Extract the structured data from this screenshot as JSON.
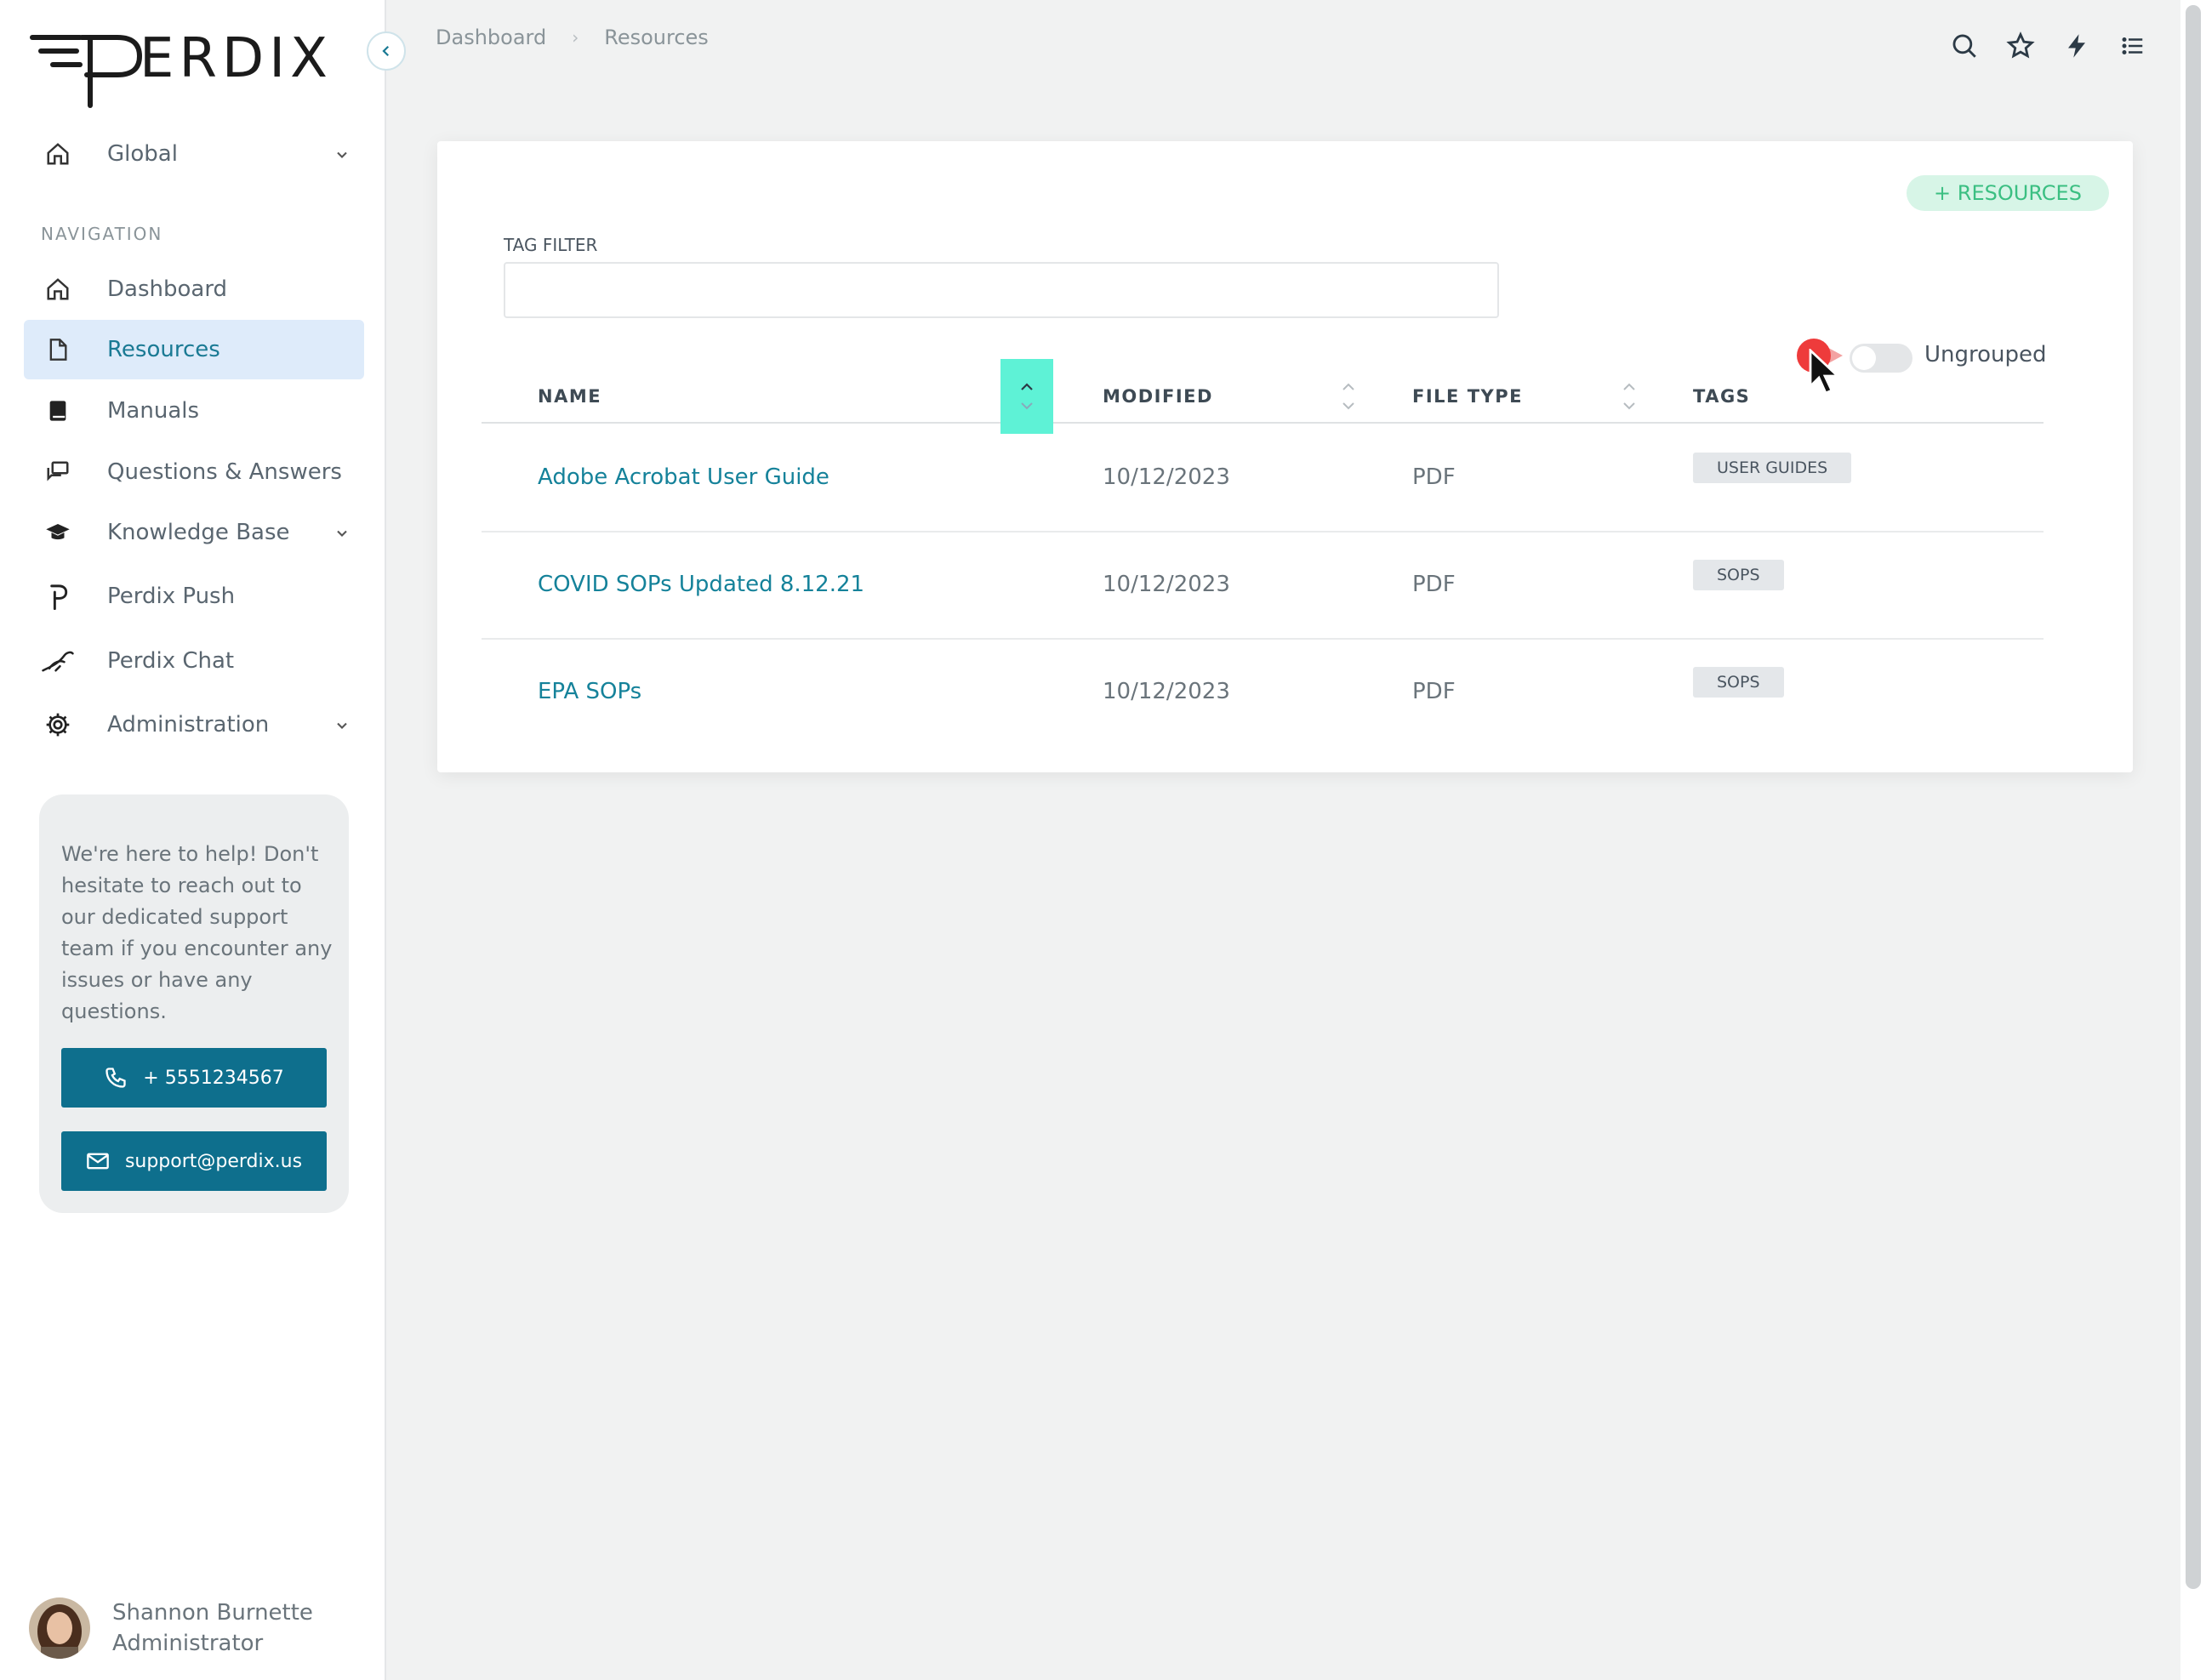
{
  "brand": {
    "logo_text": "PERDIX"
  },
  "breadcrumb": {
    "items": [
      "Dashboard",
      "Resources"
    ]
  },
  "sidebar": {
    "scope": "Global",
    "heading": "NAVIGATION",
    "items": [
      {
        "label": "Dashboard",
        "icon": "home-icon"
      },
      {
        "label": "Resources",
        "icon": "file-icon",
        "active": true
      },
      {
        "label": "Manuals",
        "icon": "book-icon"
      },
      {
        "label": "Questions & Answers",
        "icon": "chat-icon"
      },
      {
        "label": "Knowledge Base",
        "icon": "graduation-cap-icon",
        "expandable": true
      },
      {
        "label": "Perdix Push",
        "icon": "perdix-p-icon"
      },
      {
        "label": "Perdix Chat",
        "icon": "bird-icon"
      },
      {
        "label": "Administration",
        "icon": "gear-icon",
        "expandable": true
      }
    ]
  },
  "help": {
    "text": "We're here to help! Don't hesitate to reach out to our dedicated support team if you encounter any issues or have any questions.",
    "phone": "+ 5551234567",
    "email": "support@perdix.us"
  },
  "user": {
    "name": "Shannon Burnette",
    "role": "Administrator"
  },
  "card": {
    "add_button": "+ RESOURCES",
    "tag_filter_label": "TAG FILTER",
    "tag_filter_value": "",
    "toggle_label": "Ungrouped",
    "toggle_on": false
  },
  "table": {
    "columns": [
      "NAME",
      "MODIFIED",
      "FILE TYPE",
      "TAGS"
    ],
    "rows": [
      {
        "name": "Adobe Acrobat User Guide",
        "modified": "10/12/2023",
        "file_type": "PDF",
        "tag": "USER GUIDES"
      },
      {
        "name": "COVID SOPs Updated 8.12.21",
        "modified": "10/12/2023",
        "file_type": "PDF",
        "tag": "SOPS"
      },
      {
        "name": "EPA SOPs",
        "modified": "10/12/2023",
        "file_type": "PDF",
        "tag": "SOPS"
      }
    ]
  },
  "colors": {
    "accent": "#15829a",
    "active_bg": "#deebfa",
    "sort_active": "#5ef2d6",
    "button": "#0e6f8d",
    "add_btn_bg": "#d7f5e7",
    "add_btn_text": "#3bbf82"
  }
}
